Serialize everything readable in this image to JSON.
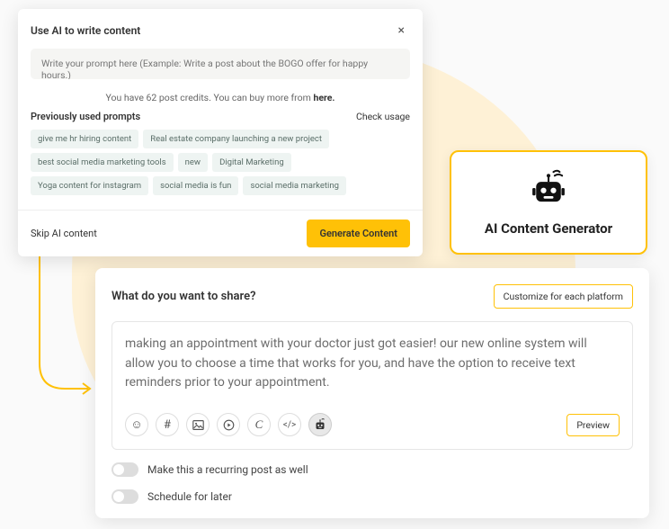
{
  "modal": {
    "title": "Use AI to write content",
    "placeholder": "Write your prompt here (Example: Write a post about the BOGO offer for happy hours.)",
    "credit_prefix": "You have 62 post credits. You can buy more from ",
    "credit_link": "here.",
    "previous_label": "Previously used prompts",
    "check_usage": "Check usage",
    "chips": [
      "give me hr hiring content",
      "Real estate company launching a new project",
      "best social media marketing tools",
      "new",
      "Digital Marketing",
      "Yoga content for instagram",
      "social media is fun",
      "social media marketing"
    ],
    "skip": "Skip AI content",
    "generate": "Generate Content"
  },
  "gen_card": {
    "title": "AI Content Generator"
  },
  "share": {
    "title": "What do you want to share?",
    "customize": "Customize for each platform",
    "body": "making an appointment with your doctor just got easier! our new online system will allow you to choose a time that works for you, and have the option to receive text reminders prior to your appointment.",
    "preview": "Preview",
    "toggle1": "Make this a recurring post as well",
    "toggle2": "Schedule for later"
  }
}
